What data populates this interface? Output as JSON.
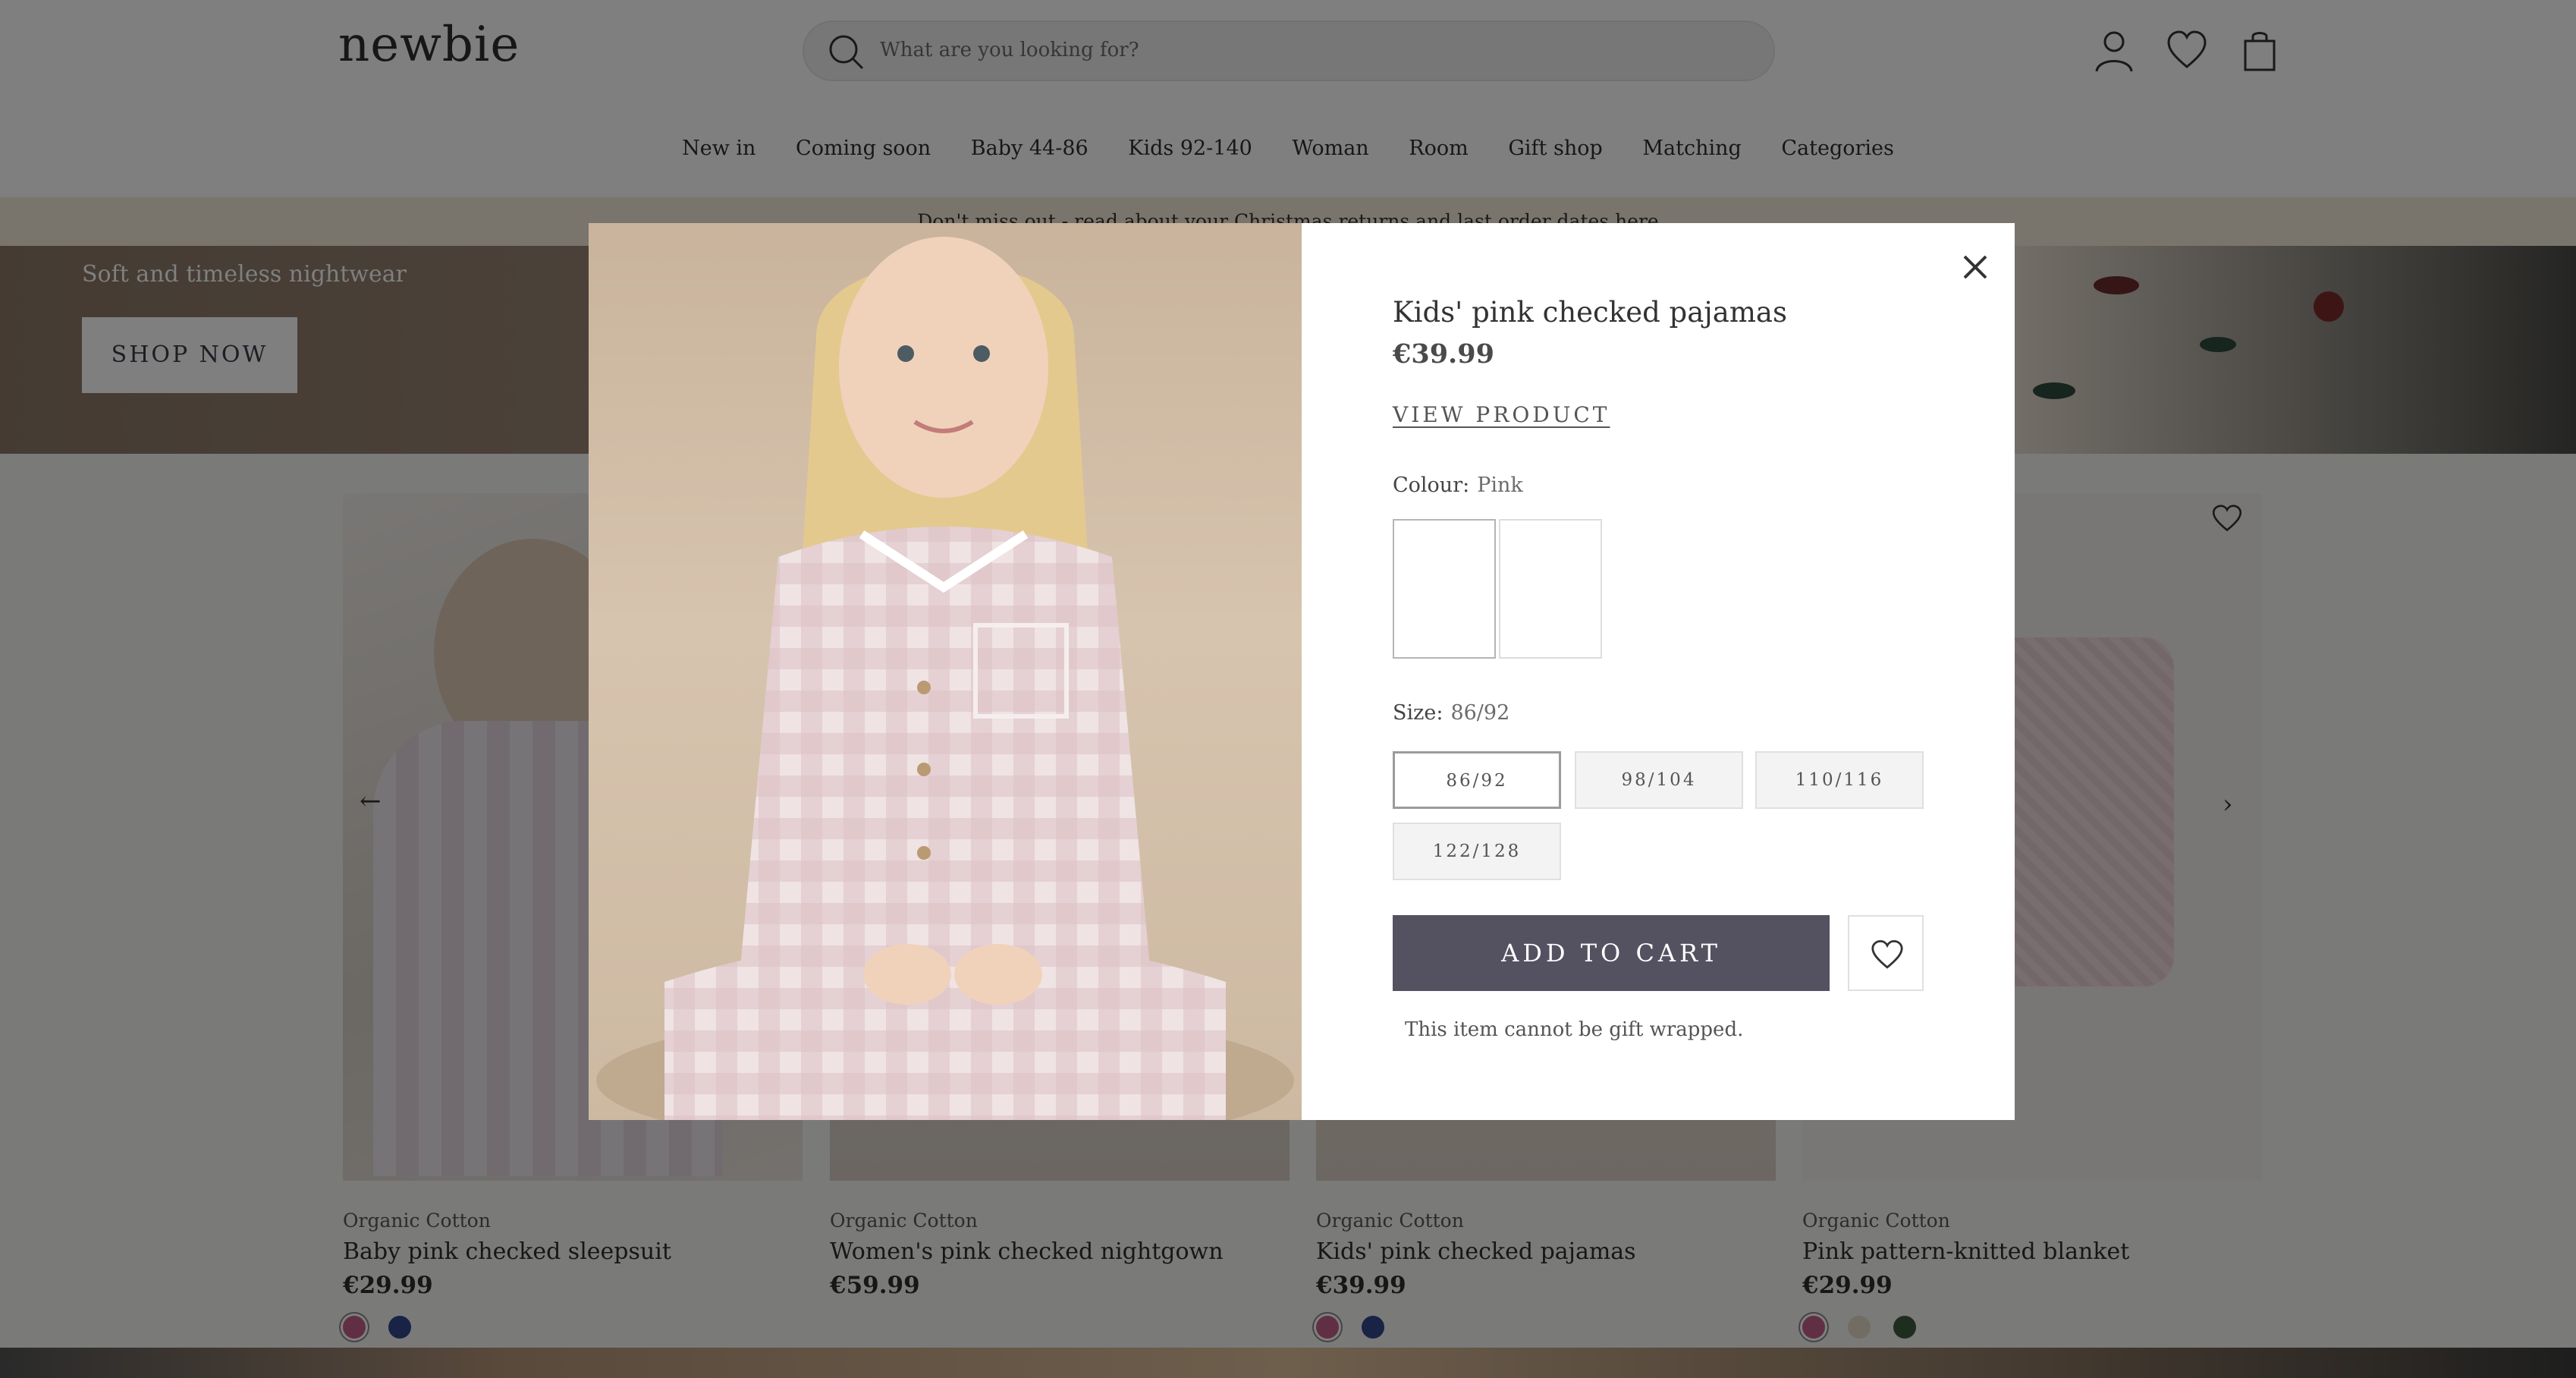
{
  "header": {
    "logo": "newbie",
    "search_placeholder": "What are you looking for?",
    "icons": [
      "search-icon",
      "account-icon",
      "heart-icon",
      "bag-icon"
    ]
  },
  "nav": [
    "New in",
    "Coming soon",
    "Baby 44-86",
    "Kids 92-140",
    "Woman",
    "Room",
    "Gift shop",
    "Matching",
    "Categories"
  ],
  "banner": "Don't miss out - read about your Christmas returns and last order dates here",
  "hero": {
    "subtitle": "Soft and timeless nightwear",
    "cta": "SHOP NOW"
  },
  "products": [
    {
      "brand": "Organic Cotton",
      "name": "Baby pink checked sleepsuit",
      "price": "€29.99",
      "swatches": [
        "#c25f86",
        "#31478a"
      ]
    },
    {
      "brand": "Organic Cotton",
      "name": "Women's pink checked nightgown",
      "price": "€59.99",
      "swatches": []
    },
    {
      "brand": "Organic Cotton",
      "name": "Kids' pink checked pajamas",
      "price": "€39.99",
      "swatches": [
        "#c25f86",
        "#31478a"
      ]
    },
    {
      "brand": "Organic Cotton",
      "name": "Pink pattern-knitted blanket",
      "price": "€29.99",
      "swatches": [
        "#c25f86",
        "#e4dac4",
        "#3e5a3e"
      ]
    }
  ],
  "modal": {
    "title": "Kids' pink checked pajamas",
    "price": "€39.99",
    "view_product": "VIEW PRODUCT",
    "colour_label": "Colour:",
    "colour_value": "Pink",
    "size_label": "Size:",
    "size_value": "86/92",
    "sizes": [
      "86/92",
      "98/104",
      "110/116",
      "122/128"
    ],
    "add_to_cart": "ADD TO CART",
    "note": "This item cannot be gift wrapped."
  }
}
